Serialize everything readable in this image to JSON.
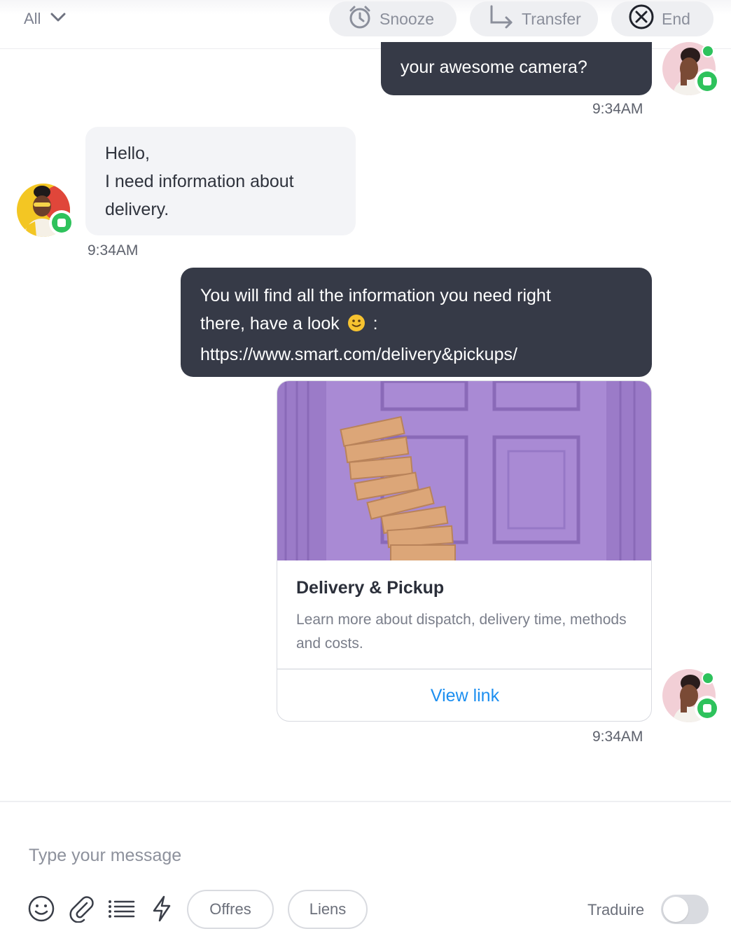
{
  "header": {
    "filter_label": "All",
    "actions": [
      {
        "label": "Snooze",
        "icon": "alarm-clock-icon"
      },
      {
        "label": "Transfer",
        "icon": "transfer-arrow-icon"
      },
      {
        "label": "End",
        "icon": "close-circle-icon"
      }
    ]
  },
  "messages": [
    {
      "sender": "agent",
      "text": "your awesome camera?",
      "time": "9:34AM"
    },
    {
      "sender": "customer",
      "lines": [
        "Hello,",
        "I need information about",
        "delivery."
      ],
      "time": "9:34AM"
    },
    {
      "sender": "agent",
      "lines": [
        "You will find all the information you need right",
        "there, have a look",
        ":",
        "https://www.smart.com/delivery&pickups/"
      ],
      "emoji": "🙂"
    },
    {
      "sender": "agent",
      "card": {
        "title": "Delivery & Pickup",
        "description": "Learn more about dispatch, delivery time, methods and costs.",
        "link_label": "View link"
      },
      "time": "9:34AM"
    }
  ],
  "composer": {
    "placeholder": "Type your message",
    "chips": [
      "Offres",
      "Liens"
    ],
    "translate_label": "Traduire",
    "translate_enabled": false
  },
  "colors": {
    "agent_bubble": "#363a47",
    "customer_bubble": "#f3f4f7",
    "link": "#1d8ff0",
    "online_badge": "#2ec25c"
  }
}
